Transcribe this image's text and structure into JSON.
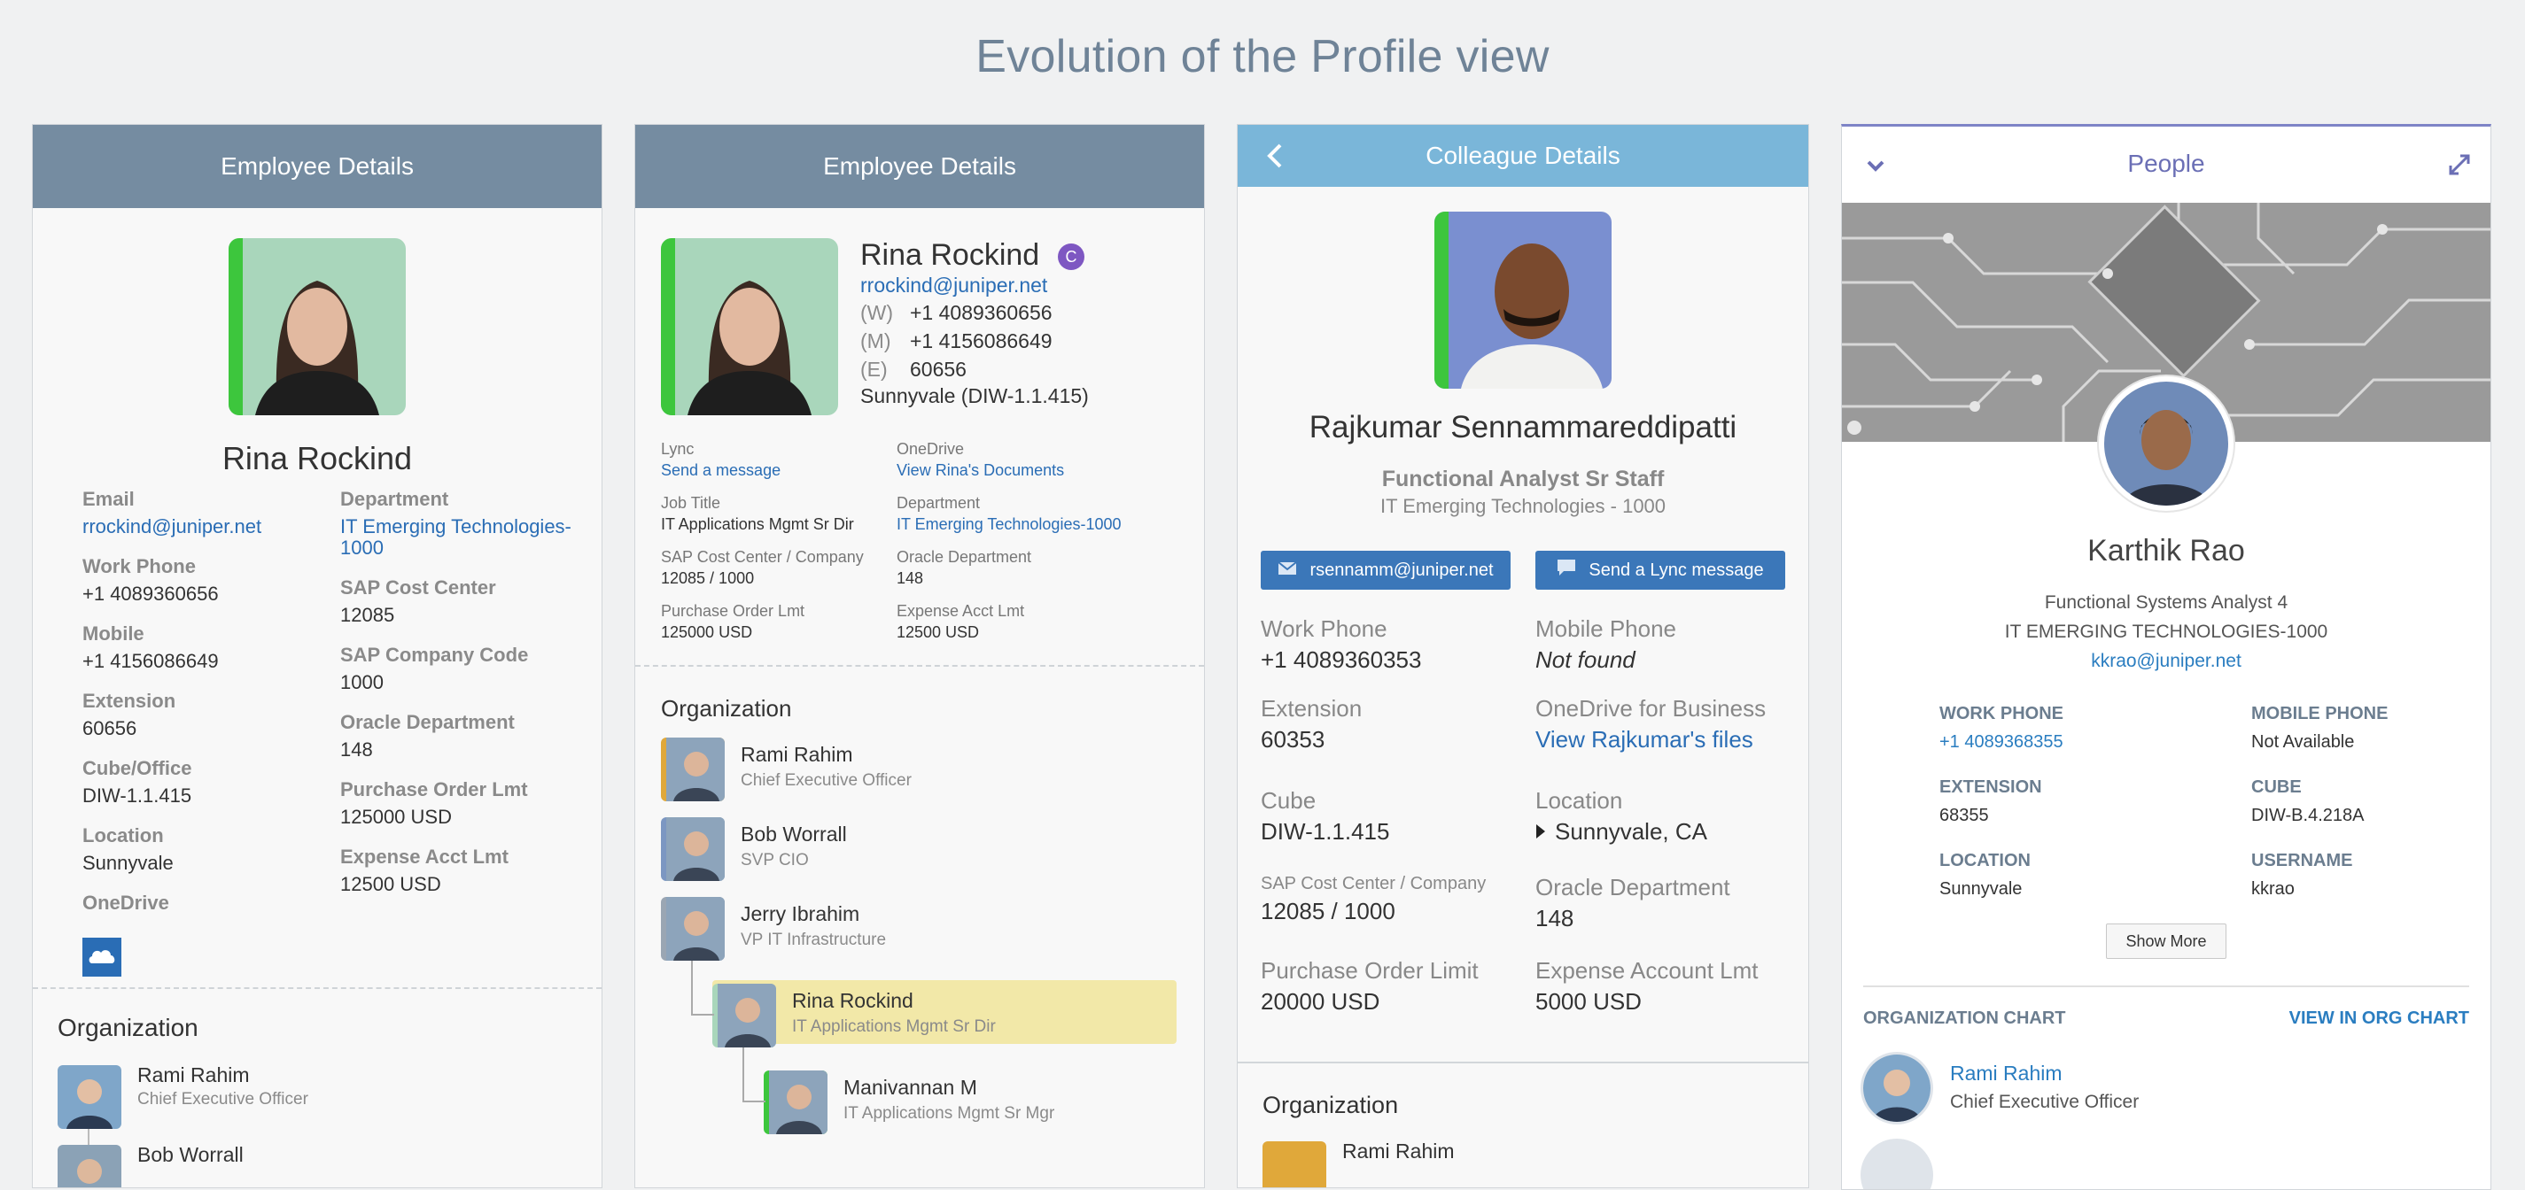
{
  "page": {
    "title": "Evolution of the Profile view"
  },
  "panel1": {
    "header": "Employee Details",
    "name": "Rina Rockind",
    "left": [
      {
        "label": "Email",
        "value": "rrockind@juniper.net",
        "link": true
      },
      {
        "label": "Work Phone",
        "value": "+1 4089360656"
      },
      {
        "label": "Mobile",
        "value": "+1 4156086649"
      },
      {
        "label": "Extension",
        "value": "60656"
      },
      {
        "label": "Cube/Office",
        "value": "DIW-1.1.415"
      },
      {
        "label": "Location",
        "value": "Sunnyvale"
      },
      {
        "label": "OneDrive",
        "value": ""
      }
    ],
    "right": [
      {
        "label": "Department",
        "value": "IT Emerging Technologies-1000",
        "link": true
      },
      {
        "label": "SAP Cost Center",
        "value": "12085"
      },
      {
        "label": "SAP Company Code",
        "value": "1000"
      },
      {
        "label": "Oracle Department",
        "value": "148"
      },
      {
        "label": "Purchase Order Lmt",
        "value": "125000 USD"
      },
      {
        "label": "Expense Acct Lmt",
        "value": "12500 USD"
      }
    ],
    "org_title": "Organization",
    "org": [
      {
        "name": "Rami Rahim",
        "title": "Chief Executive Officer"
      },
      {
        "name": "Bob Worrall",
        "title": ""
      }
    ]
  },
  "panel2": {
    "header": "Employee Details",
    "name": "Rina Rockind",
    "badge": "C",
    "email": "rrockind@juniper.net",
    "phones": [
      {
        "tag": "(W)",
        "value": "+1 4089360656"
      },
      {
        "tag": "(M)",
        "value": "+1 4156086649"
      },
      {
        "tag": "(E)",
        "value": "60656"
      }
    ],
    "office": "Sunnyvale (DIW-1.1.415)",
    "fields": [
      {
        "label": "Lync",
        "value": "Send a message",
        "link": true
      },
      {
        "label": "OneDrive",
        "value": "View Rina's Documents",
        "link": true
      },
      {
        "label": "Job Title",
        "value": "IT Applications Mgmt Sr Dir"
      },
      {
        "label": "Department",
        "value": "IT Emerging Technologies-1000",
        "link": true
      },
      {
        "label": "SAP Cost Center / Company",
        "value": "12085 / 1000"
      },
      {
        "label": "Oracle Department",
        "value": "148"
      },
      {
        "label": "Purchase Order Lmt",
        "value": "125000 USD"
      },
      {
        "label": "Expense Acct Lmt",
        "value": "12500 USD"
      }
    ],
    "org_title": "Organization",
    "org": [
      {
        "name": "Rami Rahim",
        "title": "Chief Executive Officer"
      },
      {
        "name": "Bob Worrall",
        "title": "SVP CIO"
      },
      {
        "name": "Jerry Ibrahim",
        "title": "VP IT Infrastructure"
      },
      {
        "name": "Rina Rockind",
        "title": "IT Applications Mgmt Sr Dir"
      },
      {
        "name": "Manivannan M",
        "title": "IT Applications Mgmt Sr Mgr"
      }
    ]
  },
  "panel3": {
    "header": "Colleague Details",
    "name": "Rajkumar Sennammareddipatti",
    "job": "Functional Analyst Sr Staff",
    "dept": "IT Emerging Technologies - 1000",
    "email_button": "rsennamm@juniper.net",
    "lync_button": "Send a Lync message",
    "fields": [
      {
        "label": "Work Phone",
        "value": "+1 4089360353"
      },
      {
        "label": "Mobile Phone",
        "value": "Not found"
      },
      {
        "label": "Extension",
        "value": "60353"
      },
      {
        "label": "OneDrive for Business",
        "value": "View Rajkumar's files"
      },
      {
        "label": "Cube",
        "value": "DIW-1.1.415"
      },
      {
        "label": "Location",
        "value": "Sunnyvale, CA"
      },
      {
        "label": "SAP Cost Center / Company",
        "value": "12085 / 1000"
      },
      {
        "label": "Oracle Department",
        "value": "148"
      },
      {
        "label": "Purchase Order Limit",
        "value": "20000 USD"
      },
      {
        "label": "Expense Account Lmt",
        "value": "5000 USD"
      }
    ],
    "org_title": "Organization",
    "org_first": "Rami Rahim"
  },
  "panel4": {
    "header": "People",
    "name": "Karthik Rao",
    "job": "Functional Systems Analyst 4",
    "dept": "IT EMERGING TECHNOLOGIES-1000",
    "email": "kkrao@juniper.net",
    "fields": [
      {
        "label": "WORK PHONE",
        "value": "+1 4089368355",
        "link": true
      },
      {
        "label": "MOBILE PHONE",
        "value": "Not Available"
      },
      {
        "label": "EXTENSION",
        "value": "68355"
      },
      {
        "label": "CUBE",
        "value": "DIW-B.4.218A"
      },
      {
        "label": "LOCATION",
        "value": "Sunnyvale"
      },
      {
        "label": "USERNAME",
        "value": "kkrao"
      }
    ],
    "show_more": "Show More",
    "org_chart_label": "ORGANIZATION CHART",
    "org_chart_link": "VIEW IN ORG CHART",
    "org": [
      {
        "name": "Rami Rahim",
        "title": "Chief Executive Officer"
      }
    ]
  },
  "colors": {
    "header": "#758ca1",
    "header_light": "#7ab6d9",
    "accent": "#7e84c7",
    "link": "#2a6db5",
    "green": "#3dc63d",
    "highlight": "#f2e8a8"
  }
}
